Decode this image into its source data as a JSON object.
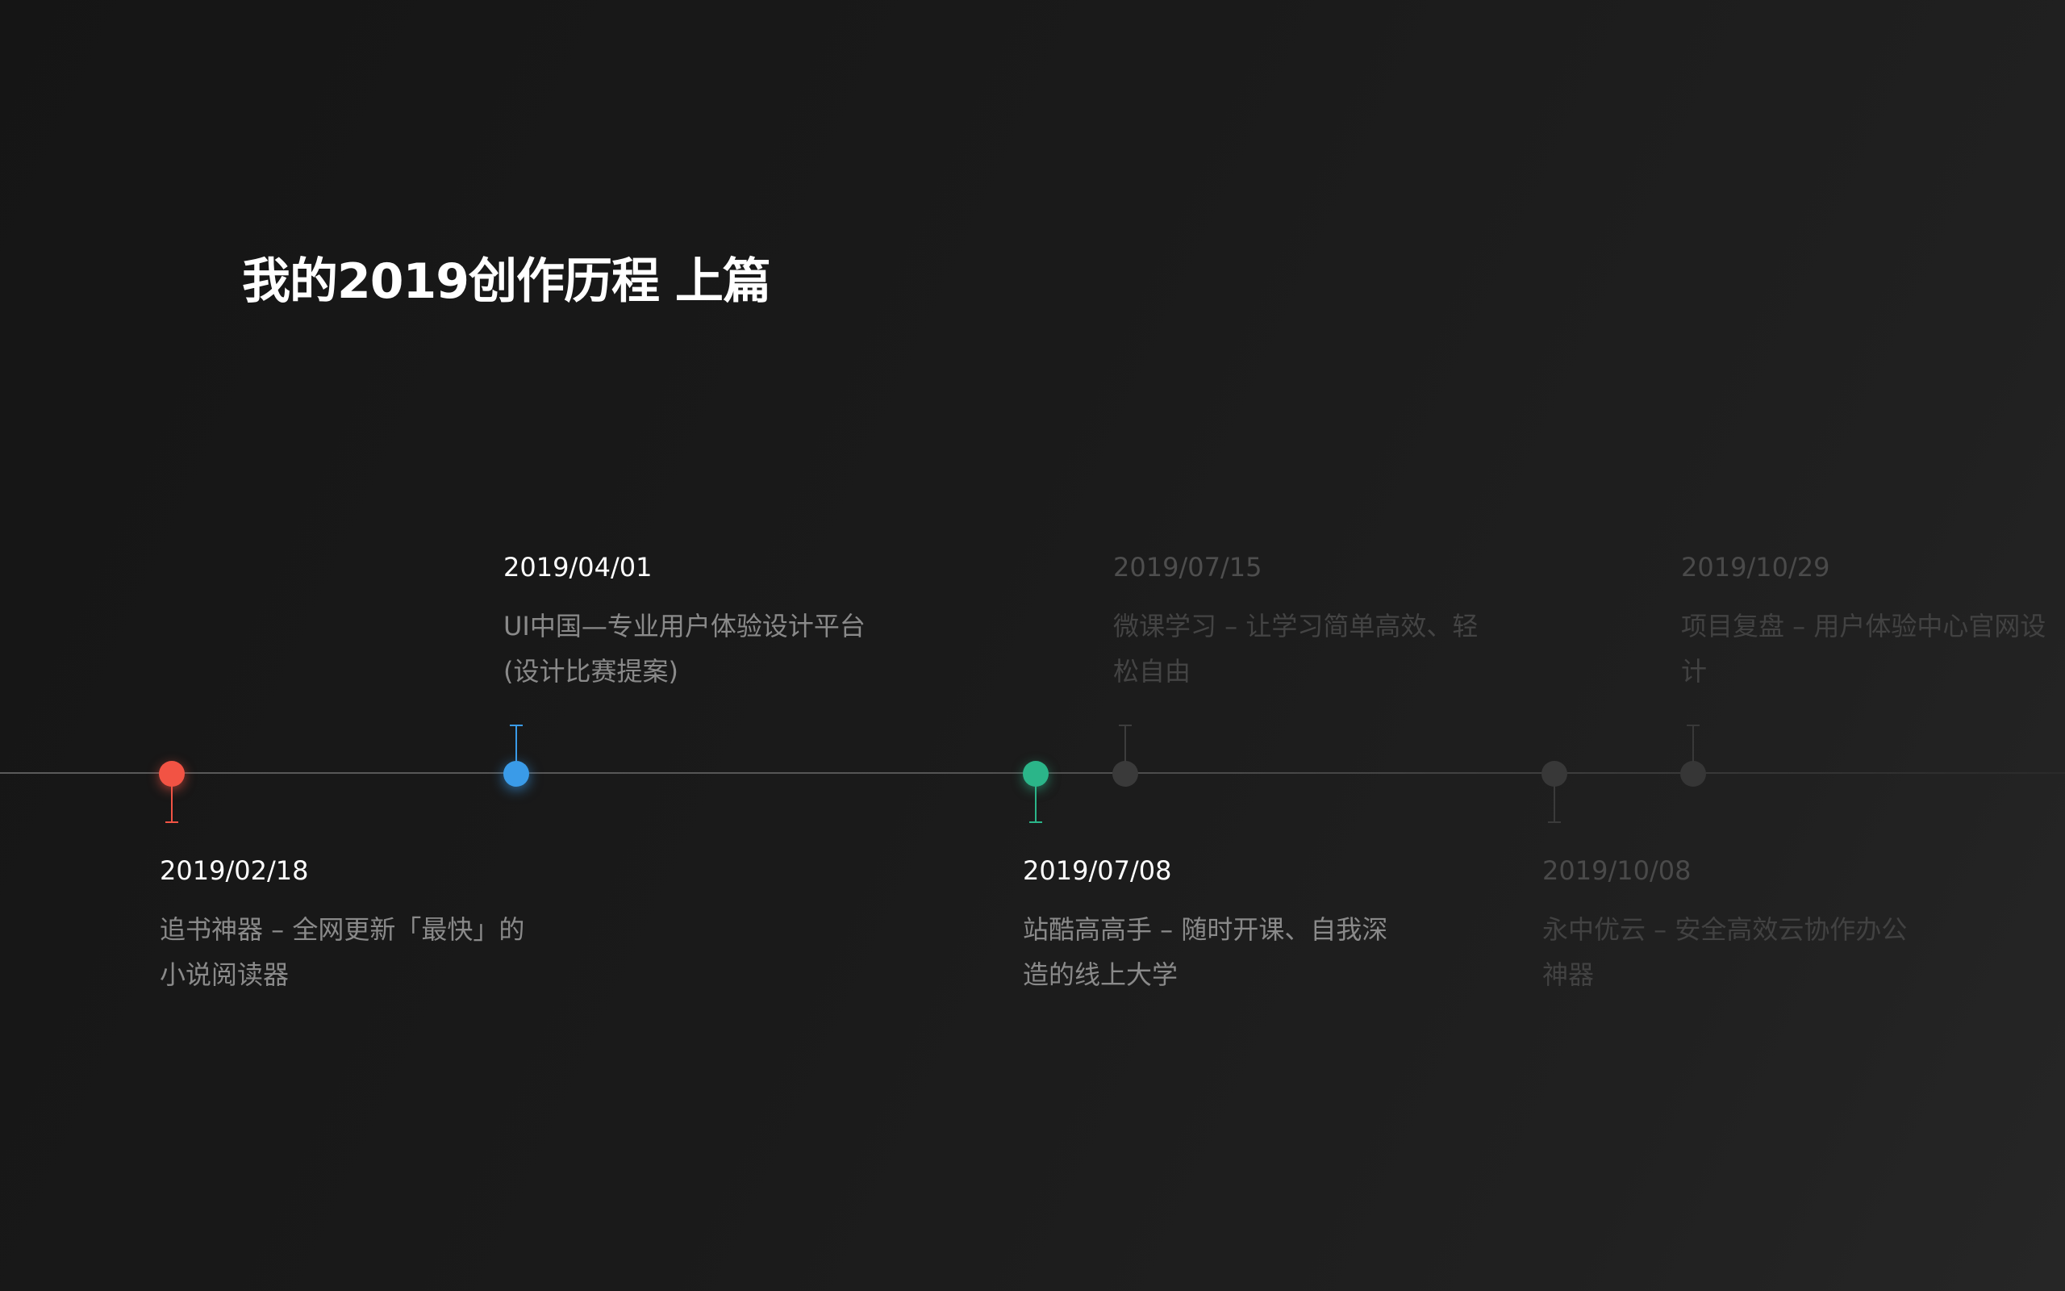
{
  "page": {
    "title": "我的2019创作历程 上篇"
  },
  "colors": {
    "red": "#f25344",
    "blue": "#3a9be8",
    "green": "#2bb589",
    "gray": "#3a3a3a"
  },
  "timeline": {
    "events": [
      {
        "date": "2019/02/18",
        "desc_line1": "追书神器 – 全网更新「最快」的",
        "desc_line2": "小说阅读器",
        "color": "#f25344",
        "state": "active"
      },
      {
        "date": "2019/04/01",
        "desc_line1": "UI中国—专业用户体验设计平台",
        "desc_line2": "(设计比赛提案)",
        "color": "#3a9be8",
        "state": "active"
      },
      {
        "date": "2019/07/08",
        "desc_line1": "站酷高高手 – 随时开课、自我深",
        "desc_line2": "造的线上大学",
        "color": "#2bb589",
        "state": "active"
      },
      {
        "date": "2019/07/15",
        "desc_line1": "微课学习 – 让学习简单高效、轻",
        "desc_line2": "松自由",
        "color": "#3a3a3a",
        "state": "dimmed"
      },
      {
        "date": "2019/10/08",
        "desc_line1": "永中优云 – 安全高效云协作办公",
        "desc_line2": "神器",
        "color": "#3a3a3a",
        "state": "dimmed"
      },
      {
        "date": "2019/10/29",
        "desc_line1": "项目复盘 – 用户体验中心官网设",
        "desc_line2": "计",
        "color": "#3a3a3a",
        "state": "dimmed"
      }
    ]
  }
}
